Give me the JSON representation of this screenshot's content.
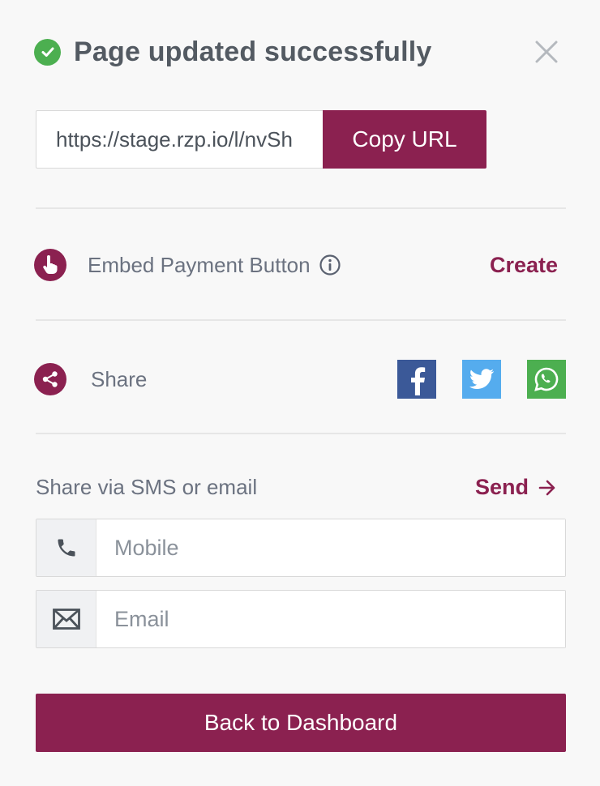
{
  "header": {
    "title": "Page updated successfully",
    "status_icon": "check-circle-icon",
    "close_icon": "close-icon"
  },
  "url_section": {
    "url_value": "https://stage.rzp.io/l/nvSh",
    "copy_label": "Copy URL"
  },
  "embed": {
    "icon": "hand-pointer-icon",
    "label": "Embed Payment Button",
    "info_icon": "info-icon",
    "action_label": "Create"
  },
  "share": {
    "icon": "share-icon",
    "label": "Share",
    "networks": [
      "facebook-icon",
      "twitter-icon",
      "whatsapp-icon"
    ]
  },
  "sms_email": {
    "label": "Share via SMS or email",
    "send_label": "Send",
    "mobile_placeholder": "Mobile",
    "email_placeholder": "Email"
  },
  "footer": {
    "back_label": "Back to Dashboard"
  },
  "colors": {
    "brand": "#8b2150",
    "success": "#4caf50",
    "facebook": "#3b5998",
    "twitter": "#55acee",
    "whatsapp": "#4caf50"
  }
}
